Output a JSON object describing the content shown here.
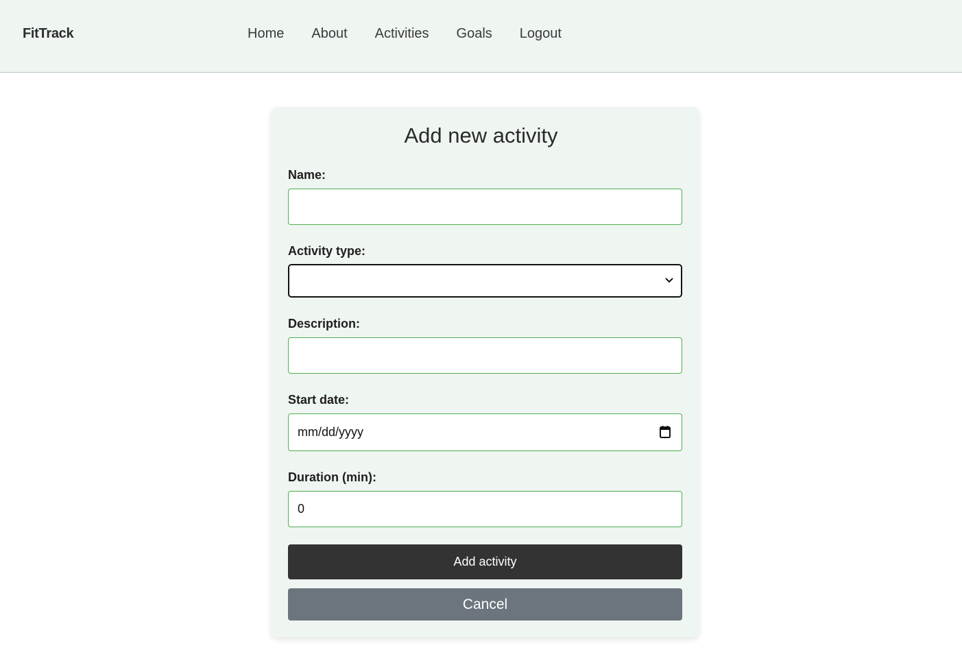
{
  "nav": {
    "brand": "FitTrack",
    "links": [
      "Home",
      "About",
      "Activities",
      "Goals",
      "Logout"
    ]
  },
  "form": {
    "title": "Add new activity",
    "name_label": "Name:",
    "name_value": "",
    "type_label": "Activity type:",
    "type_value": "",
    "description_label": "Description:",
    "description_value": "",
    "start_date_label": "Start date:",
    "start_date_placeholder": "mm/dd/yyyy",
    "duration_label": "Duration (min):",
    "duration_value": "0",
    "submit_label": "Add activity",
    "cancel_label": "Cancel"
  },
  "colors": {
    "nav_bg": "#eff5f1",
    "card_bg": "#eff5f1",
    "input_border": "#4caf50",
    "primary_btn": "#333333",
    "secondary_btn": "#6c757d"
  }
}
